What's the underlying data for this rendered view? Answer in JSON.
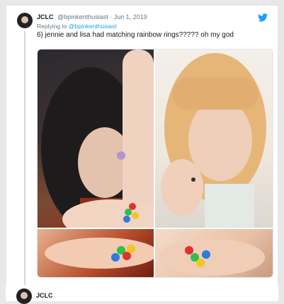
{
  "tweet": {
    "display_name": "JCLC",
    "handle": "@bpinkenthusiast",
    "separator": "·",
    "date": "Jun 1, 2019",
    "reply_prefix": "Replying to",
    "reply_mention": "@bpinkenthusiast",
    "text": "6) jennie and lisa had matching rainbow rings????? oh my god",
    "brand_icon": "twitter-bird-icon",
    "accent_color": "#1da1f2"
  },
  "next_tweet": {
    "display_name": "JCLC"
  }
}
